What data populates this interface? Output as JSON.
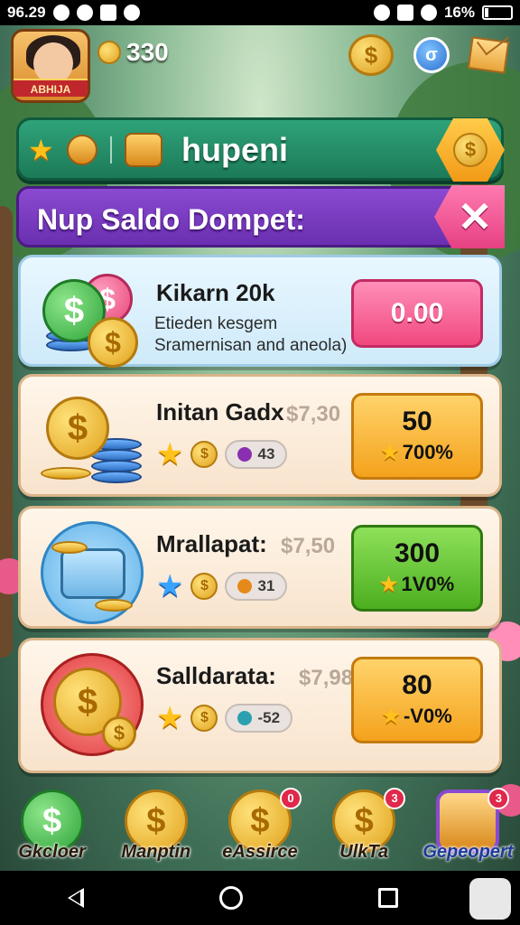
{
  "status_bar": {
    "time": "96.29",
    "battery": "16%"
  },
  "top_bar": {
    "avatar_label": "ABHIJA",
    "coin_count": "330",
    "coins_icon": "$",
    "profile_icon": "σ"
  },
  "banner": {
    "title": "hupeni",
    "coin_icon": "$"
  },
  "header": {
    "title": "Nup Saldo Dompet:",
    "close_icon": "✕"
  },
  "offers": [
    {
      "name": "Kikarn 20k",
      "description_line1": "Etieden kesgem",
      "description_line2": "Sramernisan and aneola)",
      "price": "0.00"
    },
    {
      "name": "Initan Gadx",
      "old_price": "$7,30",
      "pill_value": "43",
      "amount": "50",
      "bonus": "700%"
    },
    {
      "name": "Mrallapat:",
      "old_price": "$7,50",
      "pill_value": "31",
      "amount": "300",
      "bonus": "1V0%"
    },
    {
      "name": "Salldarata:",
      "old_price": "$7,98",
      "pill_value": "-52",
      "amount": "80",
      "bonus": "-V0%"
    }
  ],
  "tabs": [
    {
      "label": "Gkcloer",
      "badge": ""
    },
    {
      "label": "Manptin",
      "badge": ""
    },
    {
      "label": "eAssirce",
      "badge": "0"
    },
    {
      "label": "UlkTa",
      "badge": "3"
    },
    {
      "label": "Gepeopert",
      "badge": "3"
    }
  ],
  "colors": {
    "banner_green": "#1c7a58",
    "header_purple": "#6a2fb0",
    "close_pink": "#e64182",
    "price_orange": "#f4a21c",
    "price_green": "#4cae1f",
    "price_pink": "#f0487f"
  }
}
